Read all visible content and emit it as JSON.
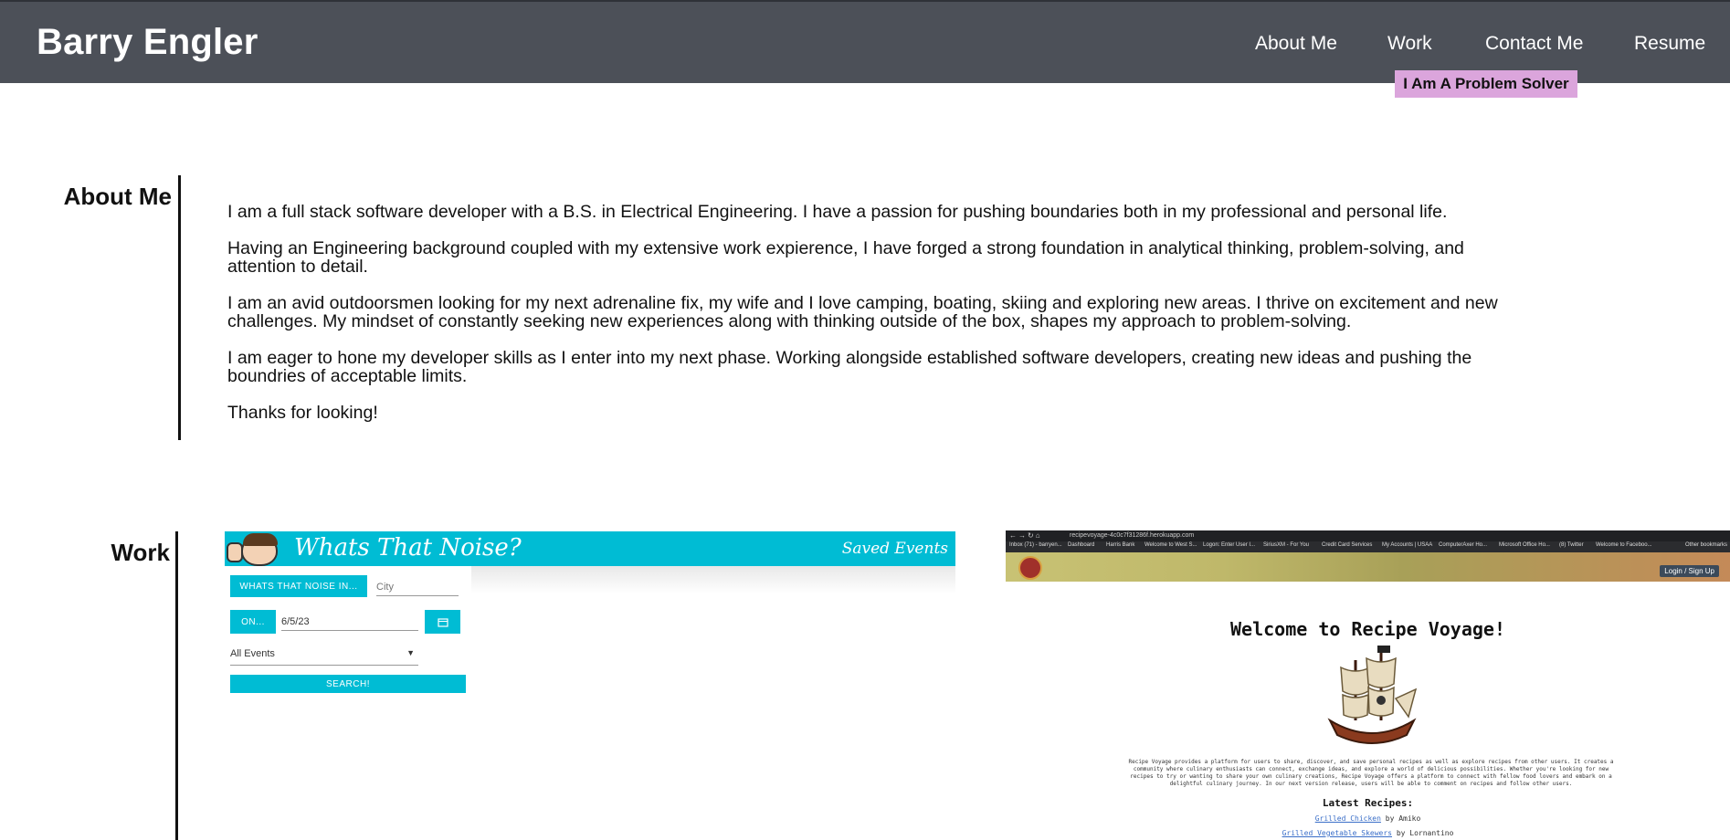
{
  "header": {
    "name": "Barry Engler",
    "nav": [
      "About Me",
      "Work",
      "Contact Me",
      "Resume"
    ],
    "tagline": "I Am A Problem Solver"
  },
  "about": {
    "title": "About Me",
    "paragraphs": [
      "I am a full stack software developer with a B.S. in Electrical Engineering. I have a passion for pushing boundaries both in my professional and personal life.",
      "Having an Engineering background coupled with my extensive work expierence, I have forged a strong foundation in analytical thinking, problem-solving, and attention to detail.",
      "I am an avid outdoorsmen looking for my next adrenaline fix, my wife and I love camping, boating, skiing and exploring new areas. I thrive on excitement and new challenges. My mindset of constantly seeking new experiences along with thinking outside of the box, shapes my approach to problem-solving.",
      "I am eager to hone my developer skills as I enter into my next phase. Working alongside established software developers, creating new ideas and pushing the boundries of acceptable limits.",
      "Thanks for looking!"
    ]
  },
  "work": {
    "title": "Work",
    "project1": {
      "title": "Whats That Noise?",
      "saved": "Saved Events",
      "btn_noise": "WHATS THAT NOISE IN...",
      "city_placeholder": "City",
      "btn_on": "ON...",
      "date_value": "6/5/23",
      "select_value": "All Events",
      "btn_search": "SEARCH!",
      "colors": {
        "accent": "#00bcd4"
      }
    },
    "project2": {
      "url": "recipevoyage-4c0c7f31286f.herokuapp.com",
      "bookmarks": [
        "Inbox (71) - barryen...",
        "Dashboard",
        "Harris Bank",
        "Welcome to West S...",
        "Logon: Enter User I...",
        "SiriusXM - For You",
        "Credit Card Services",
        "My Accounts | USAA",
        "ComputerAxer Ho...",
        "Microsoft Office Ho...",
        "(8) Twitter",
        "Welcome to Faceboo...",
        "Other bookmarks"
      ],
      "login": "Login / Sign Up",
      "heading": "Welcome to Recipe Voyage!",
      "description": "Recipe Voyage provides a platform for users to share, discover, and save personal recipes as well as explore recipes from other users. It creates a community where culinary enthusiasts can connect, exchange ideas, and explore a world of delicious possibilities. Whether you're looking for new recipes to try or wanting to share your own culinary creations, Recipe Voyage offers a platform to connect with fellow food lovers and embark on a delightful culinary journey. In our next version release, users will be able to comment on recipes and follow other users.",
      "latest_title": "Latest Recipes:",
      "recipes": [
        {
          "name": "Grilled Chicken",
          "by": "by Amiko"
        },
        {
          "name": "Grilled Vegetable Skewers",
          "by": "by Lornantino"
        }
      ]
    }
  },
  "colors": {
    "header_bg": "#4c5058",
    "tag_bg": "#dba5dc"
  }
}
